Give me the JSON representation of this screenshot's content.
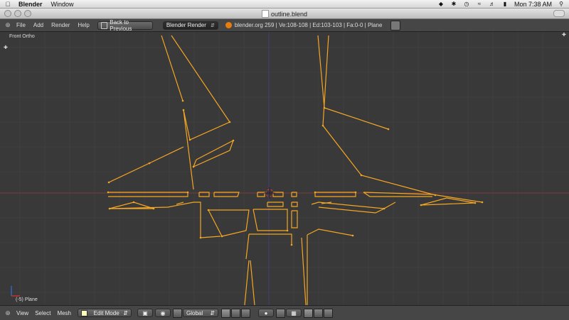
{
  "mac_menubar": {
    "apple_icon": "apple-icon",
    "app_name": "Blender",
    "menus": [
      "Window"
    ],
    "clock": "Mon 7:38 AM"
  },
  "window": {
    "title": "outline.blend"
  },
  "info_header": {
    "menus": [
      "File",
      "Add",
      "Render",
      "Help"
    ],
    "back_button": "Back to Previous",
    "render_engine": "Blender Render",
    "stats": "blender.org 259 | Ve:108-108 | Ed:103-103 | Fa:0-0 | Plane"
  },
  "viewport": {
    "view_label": "Front Ortho",
    "object_label": "(-5) Plane",
    "wire_color": "#f5a623",
    "axis_x_color": "#8b3b3b",
    "axis_z_color": "#3b3b8b"
  },
  "view3d_header": {
    "menus": [
      "View",
      "Select",
      "Mesh"
    ],
    "mode": "Edit Mode",
    "orientation": "Global"
  }
}
